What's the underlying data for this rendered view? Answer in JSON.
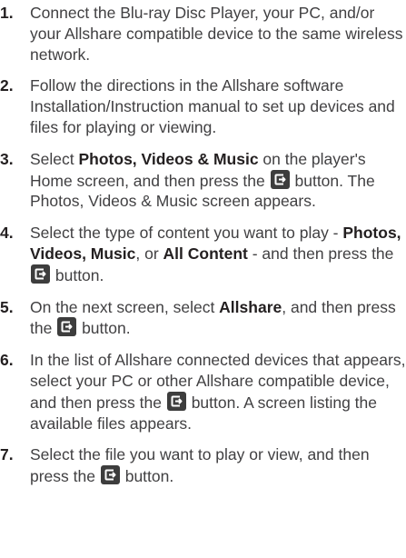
{
  "steps": [
    {
      "number": "1.",
      "parts": [
        {
          "t": "text",
          "v": "Connect the Blu-ray Disc Player, your PC, and/or your Allshare compatible device to the same wireless network."
        }
      ]
    },
    {
      "number": "2.",
      "parts": [
        {
          "t": "text",
          "v": "Follow the directions in the Allshare software Installation/Instruction manual to set up devices and files for playing or viewing."
        }
      ]
    },
    {
      "number": "3.",
      "parts": [
        {
          "t": "text",
          "v": "Select "
        },
        {
          "t": "bold",
          "v": "Photos, Videos & Music"
        },
        {
          "t": "text",
          "v": " on the player's Home screen, and then press the "
        },
        {
          "t": "icon",
          "v": "enter-icon"
        },
        {
          "t": "text",
          "v": " button. The Photos, Videos & Music screen appears."
        }
      ]
    },
    {
      "number": "4.",
      "parts": [
        {
          "t": "text",
          "v": "Select the type of content you want to play - "
        },
        {
          "t": "bold",
          "v": "Photos, Videos, Music"
        },
        {
          "t": "text",
          "v": ", or "
        },
        {
          "t": "bold",
          "v": "All Content"
        },
        {
          "t": "text",
          "v": " - and then press the "
        },
        {
          "t": "icon",
          "v": "enter-icon"
        },
        {
          "t": "text",
          "v": " button."
        }
      ]
    },
    {
      "number": "5.",
      "parts": [
        {
          "t": "text",
          "v": "On the next screen, select "
        },
        {
          "t": "bold",
          "v": "Allshare"
        },
        {
          "t": "text",
          "v": ", and then press the "
        },
        {
          "t": "icon",
          "v": "enter-icon"
        },
        {
          "t": "text",
          "v": " button."
        }
      ]
    },
    {
      "number": "6.",
      "parts": [
        {
          "t": "text",
          "v": "In the list of Allshare connected devices that appears, select your PC or other Allshare compatible device, and then press the "
        },
        {
          "t": "icon",
          "v": "enter-icon"
        },
        {
          "t": "text",
          "v": " button. A screen listing the available files appears."
        }
      ]
    },
    {
      "number": "7.",
      "parts": [
        {
          "t": "text",
          "v": "Select the file you want to play or view, and then press the "
        },
        {
          "t": "icon",
          "v": "enter-icon"
        },
        {
          "t": "text",
          "v": " button."
        }
      ]
    }
  ]
}
